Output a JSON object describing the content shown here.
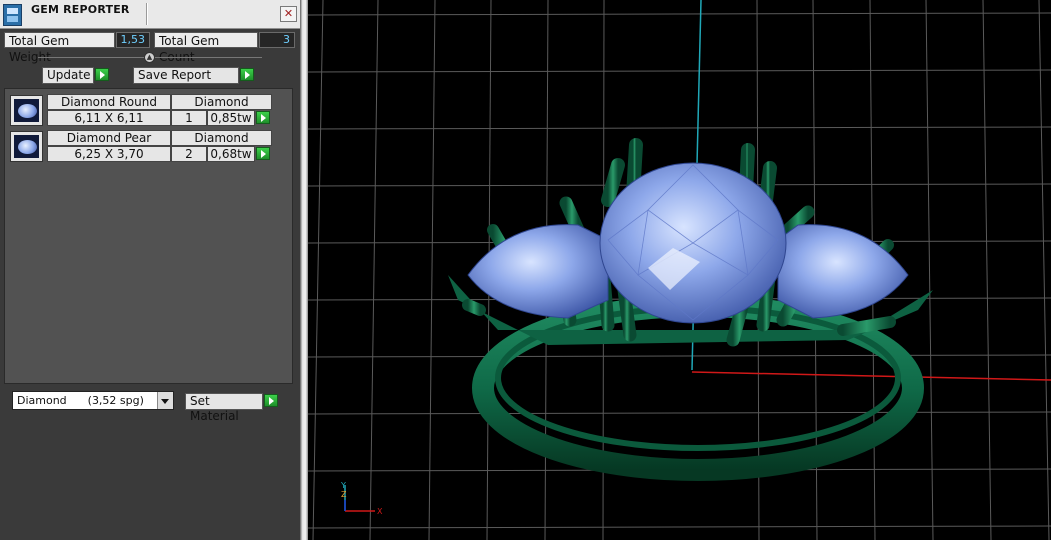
{
  "window": {
    "title": "GEM REPORTER",
    "close_glyph": "✕"
  },
  "summary": {
    "weight_label": "Total Gem Weight",
    "weight_value": "1,53",
    "count_label": "Total Gem Count",
    "count_value": "3"
  },
  "toolbar": {
    "update_label": "Update",
    "save_label": "Save Report"
  },
  "gems": [
    {
      "shape": "Diamond Round",
      "material": "Diamond",
      "size": "6,11 X 6,11",
      "count": "1",
      "weight": "0,85tw"
    },
    {
      "shape": "Diamond Pear",
      "material": "Diamond",
      "size": "6,25 X 3,70",
      "count": "2",
      "weight": "0,68tw"
    }
  ],
  "material_select": {
    "value": "Diamond      (3,52 spg)"
  },
  "set_material_label": "Set Material",
  "viewport": {
    "axis_labels": {
      "z": "Z",
      "y": "Y",
      "x": "X"
    },
    "colors": {
      "metal": "#0f6a48",
      "gem": "#7f9de6",
      "grid": "#5a5a5a",
      "axis_x": "#d01818",
      "axis_y": "#20a8b8"
    }
  },
  "icons": [
    "gem-reporter-app-icon",
    "close-icon",
    "go-arrow-icon",
    "gem-thumbnail-icon",
    "chevron-down-icon",
    "axis-gizmo-icon"
  ]
}
